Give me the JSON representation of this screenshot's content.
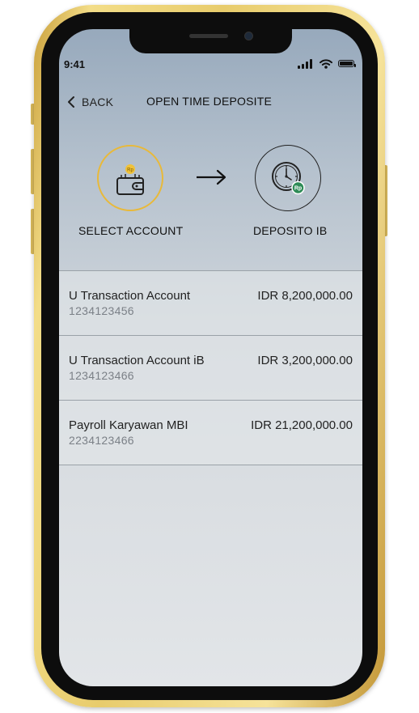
{
  "status_bar": {
    "time": "9:41"
  },
  "header": {
    "back_label": "BACK",
    "title": "OPEN TIME DEPOSITE"
  },
  "steps": [
    {
      "label": "SELECT ACCOUNT",
      "badge": "Rp",
      "icon": "wallet-icon",
      "color": "#e8b93a"
    },
    {
      "label": "DEPOSITO IB",
      "badge": "Rp",
      "icon": "clock-icon",
      "color": "#2e8b57"
    }
  ],
  "accounts": [
    {
      "name": "U Transaction Account",
      "number": "1234123456",
      "balance": "IDR 8,200,000.00"
    },
    {
      "name": "U Transaction Account iB",
      "number": "1234123466",
      "balance": "IDR 3,200,000.00"
    },
    {
      "name": "Payroll Karyawan MBI",
      "number": "2234123466",
      "balance": "IDR 21,200,000.00"
    }
  ]
}
